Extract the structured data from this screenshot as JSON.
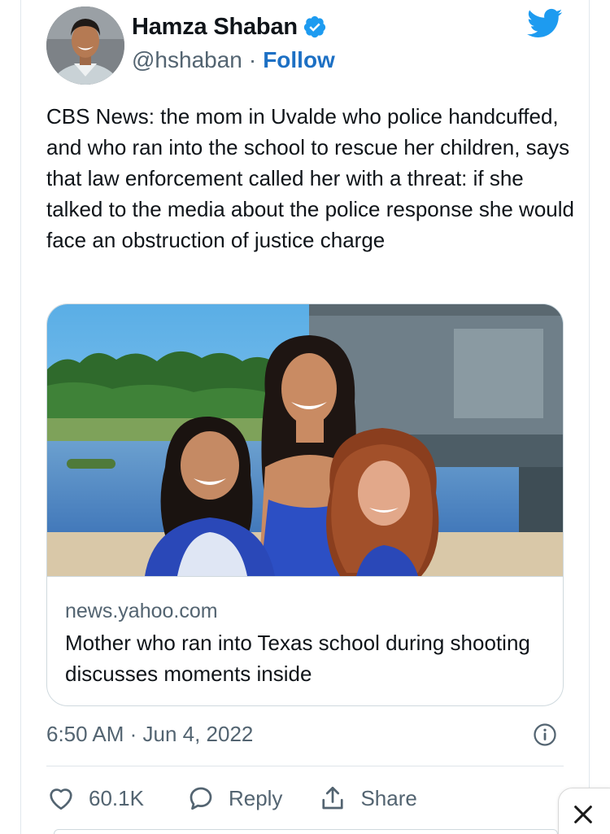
{
  "author": {
    "display_name": "Hamza Shaban",
    "handle": "@hshaban",
    "separator": "·",
    "follow_label": "Follow",
    "verified": true,
    "avatar_icon": "profile-photo"
  },
  "platform_icon": "twitter-bird-icon",
  "tweet": {
    "text": "CBS News: the mom in Uvalde who police handcuffed, and who ran into the school to rescue her children, says that law enforcement called her with a threat: if she talked to the media about the police response she would face an obstruction of justice charge",
    "timestamp": "6:50 AM · Jun 4, 2022"
  },
  "link_card": {
    "domain": "news.yahoo.com",
    "title": "Mother who ran into Texas school during shooting discusses moments inside",
    "image": "photo-mother-and-two-daughters-by-water"
  },
  "actions": {
    "like_count": "60.1K",
    "reply_label": "Reply",
    "share_label": "Share"
  },
  "colors": {
    "accent": "#1d9bf0",
    "follow": "#1d70c4",
    "muted_text": "#536471",
    "border": "#cfd9de"
  }
}
